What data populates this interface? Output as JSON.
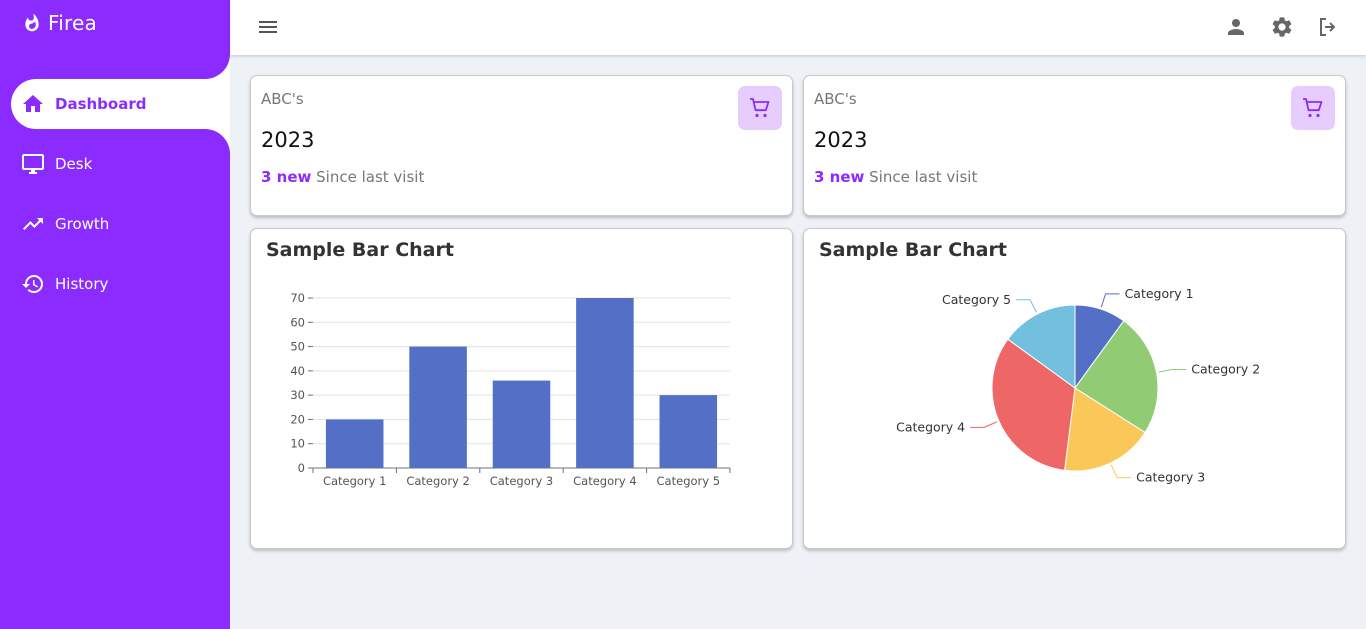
{
  "app": {
    "name": "Firea"
  },
  "sidebar": {
    "items": [
      {
        "label": "Dashboard",
        "icon": "home-icon"
      },
      {
        "label": "Desk",
        "icon": "monitor-icon"
      },
      {
        "label": "Growth",
        "icon": "trending-up-icon"
      },
      {
        "label": "History",
        "icon": "history-icon"
      }
    ]
  },
  "topbar": {
    "icons": [
      "menu-icon",
      "account-icon",
      "settings-icon",
      "logout-icon"
    ]
  },
  "colors": {
    "accent": "#8c2bff",
    "badge_bg": "#e6cdfd",
    "bar": "#5470c6"
  },
  "cards": [
    {
      "label": "ABC's",
      "value": "2023",
      "highlight": "3 new",
      "footnote": "Since last visit",
      "icon": "cart-icon"
    },
    {
      "label": "ABC's",
      "value": "2023",
      "highlight": "3 new",
      "footnote": "Since last visit",
      "icon": "cart-icon"
    }
  ],
  "chart_data": [
    {
      "type": "bar",
      "title": "Sample Bar Chart",
      "categories": [
        "Category 1",
        "Category 2",
        "Category 3",
        "Category 4",
        "Category 5"
      ],
      "values": [
        20,
        50,
        36,
        70,
        30
      ],
      "yticks": [
        "0",
        "10",
        "20",
        "30",
        "40",
        "50",
        "60",
        "70"
      ],
      "ylim": [
        0,
        70
      ],
      "grid": true,
      "color": "#5470c6"
    },
    {
      "type": "pie",
      "title": "Sample Bar Chart",
      "labels": [
        "Category 1",
        "Category 2",
        "Category 3",
        "Category 4",
        "Category 5"
      ],
      "values": [
        10,
        24,
        18,
        33,
        15
      ],
      "colors": [
        "#5470c6",
        "#91cc75",
        "#fac858",
        "#ee6666",
        "#73c0de"
      ]
    }
  ]
}
